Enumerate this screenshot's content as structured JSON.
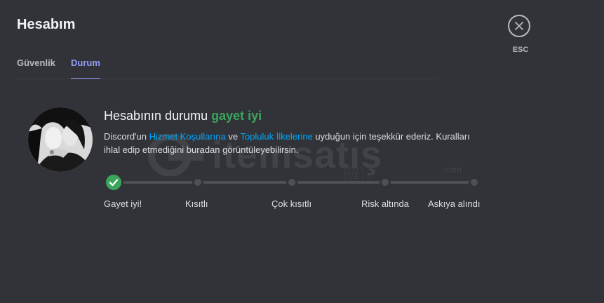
{
  "header": {
    "title": "Hesabım"
  },
  "tabs": [
    {
      "label": "Güvenlik"
    },
    {
      "label": "Durum"
    }
  ],
  "close": {
    "label": "ESC"
  },
  "status": {
    "prefix": "Hesabının durumu ",
    "value": "gayet iyi",
    "desc_part1": "Discord'un ",
    "link_terms": "Hizmet Koşullarına",
    "desc_part2": " ve ",
    "link_guidelines": "Topluluk İlkelerine",
    "desc_part3": " uyduğun için teşekkür ederiz. Kuralları ihlal edip etmediğini buradan görüntüleyebilirsin."
  },
  "steps": [
    {
      "label": "Gayet iyi!"
    },
    {
      "label": "Kısıtlı"
    },
    {
      "label": "Çok kısıtlı"
    },
    {
      "label": "Risk altında"
    },
    {
      "label": "Askıya alındı"
    }
  ],
  "current_step": 0,
  "watermark": {
    "text": "itemsatış",
    "domain": ".com",
    "sub": "HESAP / SKIN / ITEM / E-PIN"
  },
  "colors": {
    "background": "#313338",
    "accent": "#949cf7",
    "good": "#3ba55c",
    "link": "#00a8fc"
  }
}
